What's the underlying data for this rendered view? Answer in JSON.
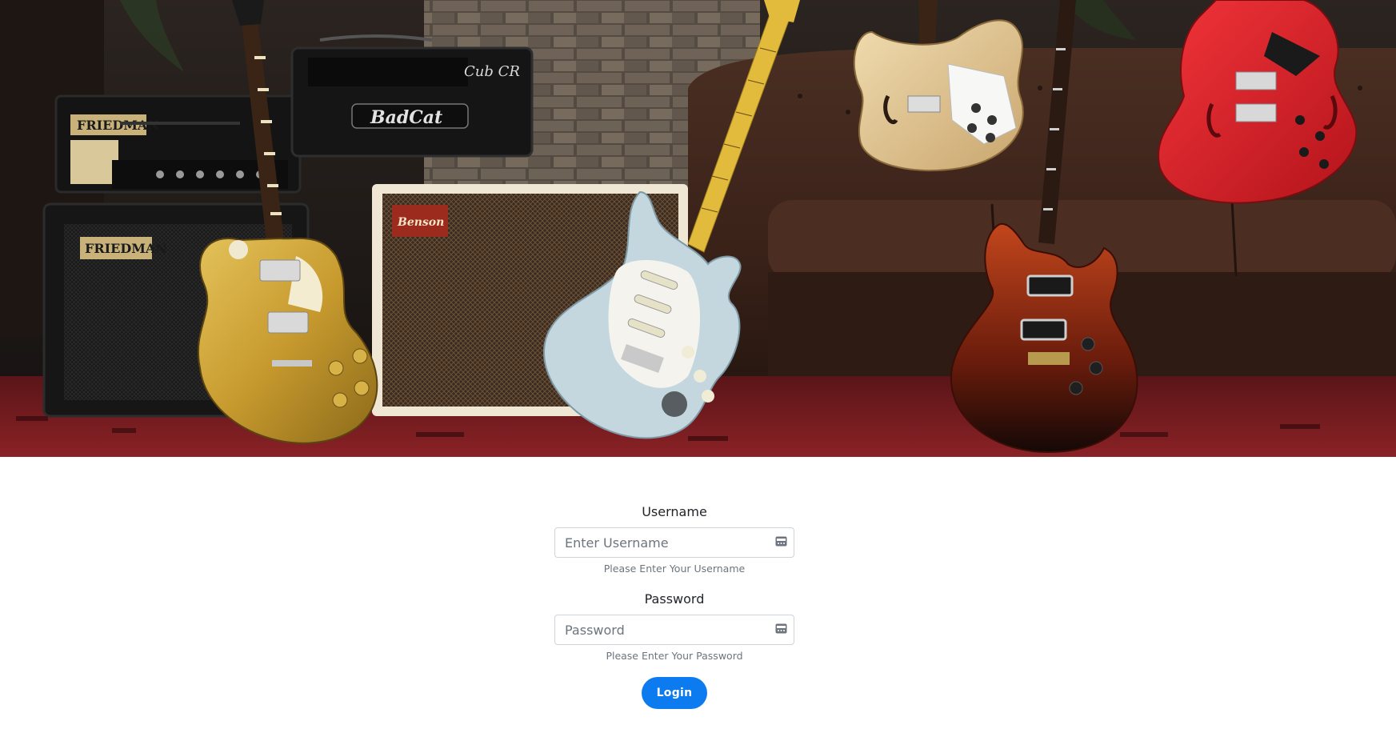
{
  "hero": {
    "image": "guitars-and-amplifiers-photo",
    "amp_brands": [
      "FRIEDMAN",
      "FRIEDMAN",
      "BadCat",
      "Cub CR",
      "Benson"
    ]
  },
  "form": {
    "username": {
      "label": "Username",
      "placeholder": "Enter Username",
      "value": "",
      "help": "Please Enter Your Username",
      "icon": "password-manager-key-icon"
    },
    "password": {
      "label": "Password",
      "placeholder": "Password",
      "value": "",
      "help": "Please Enter Your Password",
      "icon": "password-manager-key-icon"
    },
    "login_label": "Login"
  },
  "colors": {
    "primary": "#0d7bf0",
    "muted_text": "#6c757d",
    "input_border": "#ced4da"
  }
}
